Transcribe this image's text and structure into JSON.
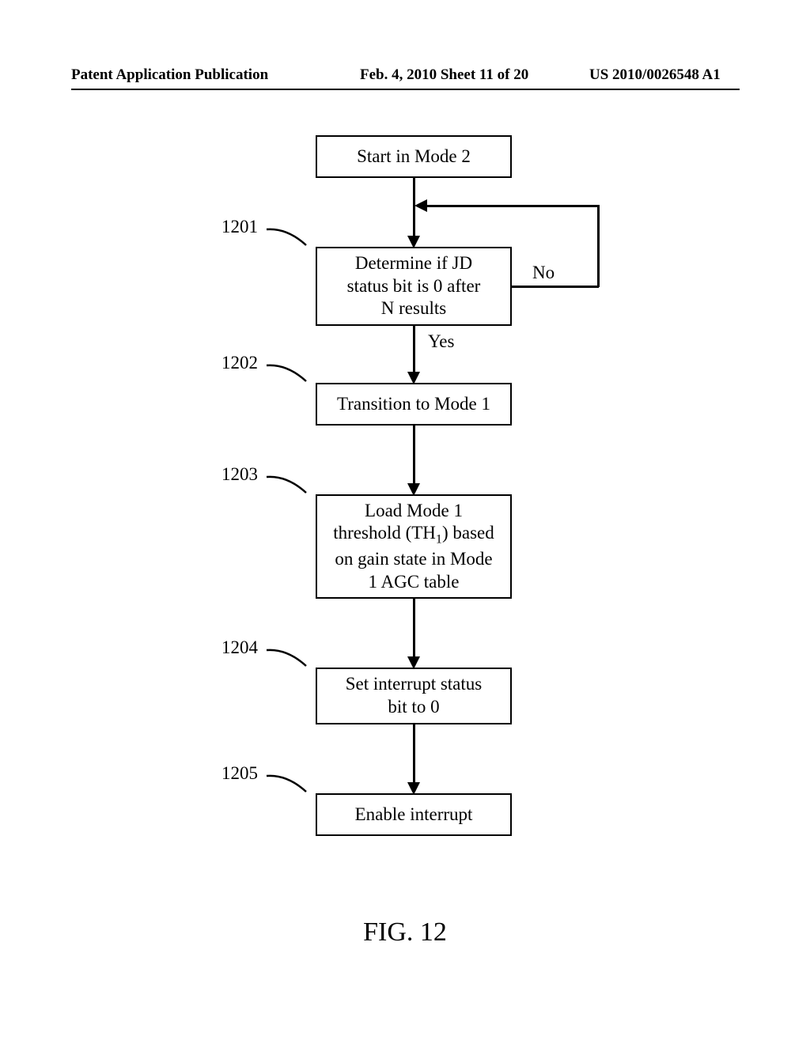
{
  "header": {
    "left": "Patent Application Publication",
    "center": "Feb. 4, 2010   Sheet 11 of 20",
    "right": "US 2010/0026548 A1"
  },
  "boxes": {
    "start": "Start in Mode 2",
    "b1201_l1": "Determine if JD",
    "b1201_l2": "status bit is 0 after",
    "b1201_l3": "N results",
    "b1202": "Transition to Mode 1",
    "b1203_l1": "Load Mode 1",
    "b1203_l2_pre": "threshold (TH",
    "b1203_l2_sub": "1",
    "b1203_l2_post": ") based",
    "b1203_l3": "on gain state in Mode",
    "b1203_l4": "1 AGC table",
    "b1204_l1": "Set interrupt status",
    "b1204_l2": "bit to 0",
    "b1205": "Enable interrupt"
  },
  "labels": {
    "no": "No",
    "yes": "Yes"
  },
  "refs": {
    "r1201": "1201",
    "r1202": "1202",
    "r1203": "1203",
    "r1204": "1204",
    "r1205": "1205"
  },
  "figure": "FIG. 12"
}
